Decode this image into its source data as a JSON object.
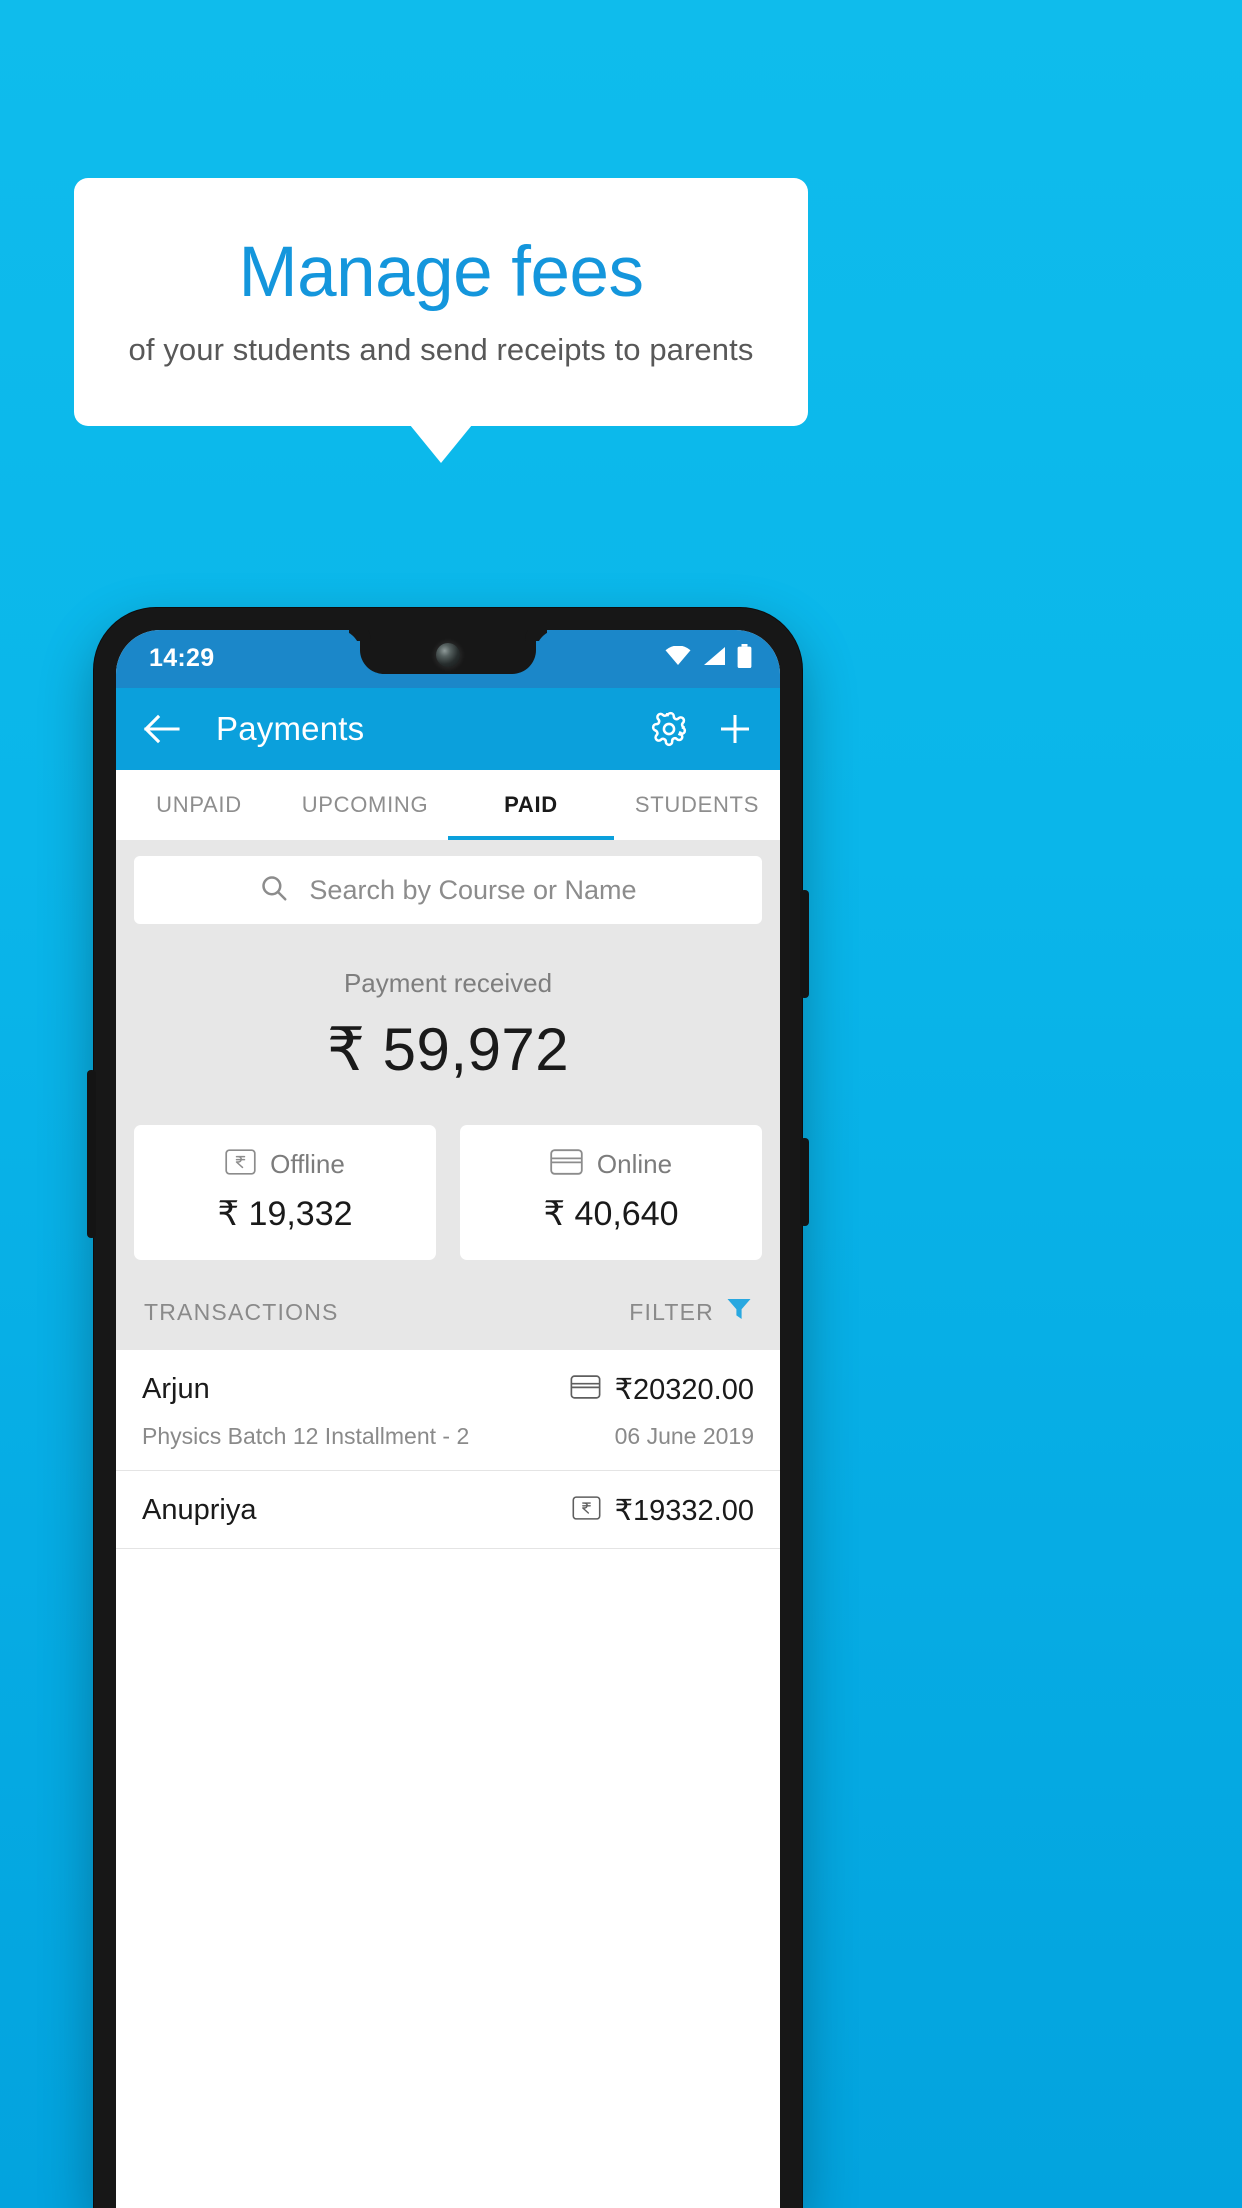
{
  "promo": {
    "background_color": "#0AB6EA",
    "headline": "Manage fees",
    "headline_color": "#1496DC",
    "subheadline": "of your students and send receipts to parents"
  },
  "phone": {
    "status_bar": {
      "time": "14:29",
      "background_color": "#1B87C9",
      "icons": [
        "wifi-icon",
        "signal-icon",
        "battery-icon"
      ]
    },
    "app_bar": {
      "background_color": "#0BA0DC",
      "back_icon": "arrow-left-icon",
      "title": "Payments",
      "settings_icon": "gear-icon",
      "add_icon": "plus-icon"
    },
    "tabs": [
      {
        "label": "UNPAID",
        "active": false
      },
      {
        "label": "UPCOMING",
        "active": false
      },
      {
        "label": "PAID",
        "active": true
      },
      {
        "label": "STUDENTS",
        "active": false
      }
    ],
    "tab_accent_color": "#0BA0DC",
    "search": {
      "icon": "search-icon",
      "placeholder": "Search by Course or Name"
    },
    "summary": {
      "label": "Payment received",
      "amount": "₹ 59,972"
    },
    "breakdown": [
      {
        "icon": "rupee-note-icon",
        "label": "Offline",
        "value": "₹ 19,332"
      },
      {
        "icon": "credit-card-icon",
        "label": "Online",
        "value": "₹ 40,640"
      }
    ],
    "transactions_header": {
      "title": "TRANSACTIONS",
      "filter_label": "FILTER",
      "filter_icon": "funnel-icon",
      "filter_icon_color": "#29A8E0"
    },
    "transactions": [
      {
        "name": "Arjun",
        "method_icon": "credit-card-icon",
        "amount": "₹20320.00",
        "description": "Physics Batch 12 Installment - 2",
        "date": "06 June 2019"
      },
      {
        "name": "Anupriya",
        "method_icon": "rupee-note-icon",
        "amount": "₹19332.00",
        "description": "",
        "date": ""
      }
    ]
  }
}
